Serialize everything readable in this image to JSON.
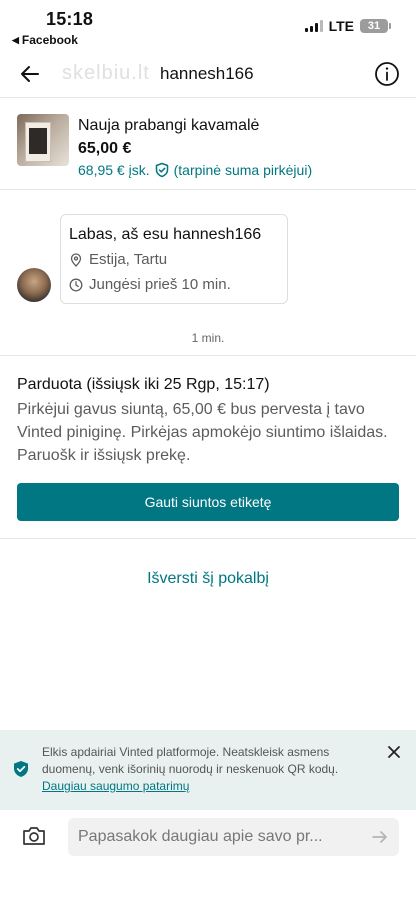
{
  "status_bar": {
    "time": "15:18",
    "back_app": "Facebook",
    "network": "LTE",
    "battery": "31"
  },
  "header": {
    "watermark": "skelbiu.lt",
    "title": "hannesh166",
    "icons": {
      "back": "arrow-left-icon",
      "info": "info-icon"
    }
  },
  "item": {
    "title": "Nauja prabangi kavamalė",
    "price": "65,00 €",
    "total_price": "68,95 € įsk.",
    "total_note": "(tarpinė suma pirkėjui)"
  },
  "profile": {
    "name": "Labas, aš esu hannesh166",
    "location": "Estija, Tartu",
    "last_seen": "Jungėsi prieš 10 min."
  },
  "message_time": "1 min.",
  "sold": {
    "title": "Parduota (išsiųsk iki 25 Rgp, 15:17)",
    "description": "Pirkėjui gavus siuntą, 65,00 € bus pervesta į tavo Vinted piniginę. Pirkėjas apmokėjo siuntimo išlaidas. Paruošk ir išsiųsk prekę.",
    "button_label": "Gauti siuntos etiketę"
  },
  "translate_label": "Išversti šį pokalbį",
  "safety": {
    "text": "Elkis apdairiai Vinted platformoje. Neatskleisk asmens duomenų, venk išorinių nuorodų ir neskenuok QR kodų.",
    "link": "Daugiau saugumo patarimų"
  },
  "composer": {
    "placeholder": "Papasakok daugiau apie savo pr..."
  },
  "colors": {
    "accent": "#007782",
    "banner_bg": "#e8f0f0"
  }
}
